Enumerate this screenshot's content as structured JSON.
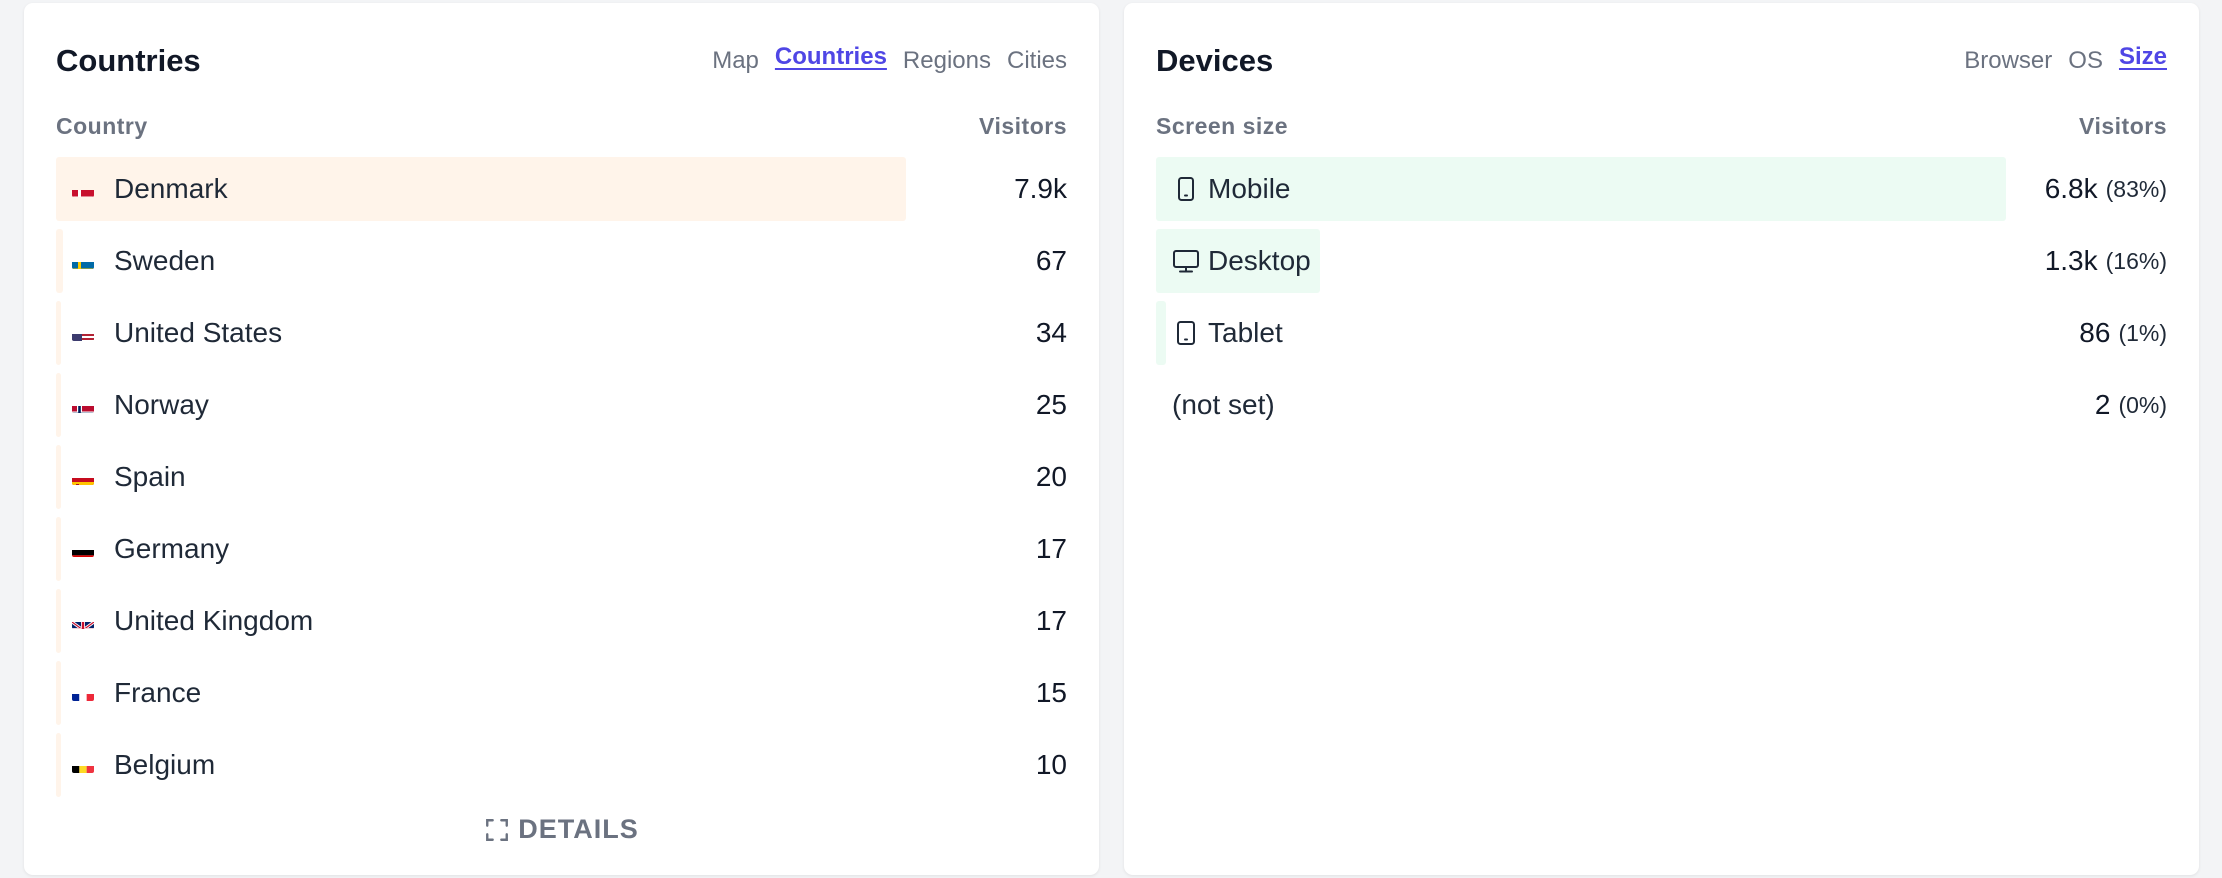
{
  "countries_card": {
    "title": "Countries",
    "tabs": [
      {
        "label": "Map",
        "active": false
      },
      {
        "label": "Countries",
        "active": true
      },
      {
        "label": "Regions",
        "active": false
      },
      {
        "label": "Cities",
        "active": false
      }
    ],
    "col_left": "Country",
    "col_right": "Visitors",
    "rows": [
      {
        "name": "Denmark",
        "value": "7.9k",
        "flag": "denmark-flag-icon",
        "share": 1.0
      },
      {
        "name": "Sweden",
        "value": "67",
        "flag": "sweden-flag-icon",
        "share": 0.0085
      },
      {
        "name": "United States",
        "value": "34",
        "flag": "united-states-flag-icon",
        "share": 0.0043
      },
      {
        "name": "Norway",
        "value": "25",
        "flag": "norway-flag-icon",
        "share": 0.0032
      },
      {
        "name": "Spain",
        "value": "20",
        "flag": "spain-flag-icon",
        "share": 0.0025
      },
      {
        "name": "Germany",
        "value": "17",
        "flag": "germany-flag-icon",
        "share": 0.0022
      },
      {
        "name": "United Kingdom",
        "value": "17",
        "flag": "united-kingdom-flag-icon",
        "share": 0.0022
      },
      {
        "name": "France",
        "value": "15",
        "flag": "france-flag-icon",
        "share": 0.0019
      },
      {
        "name": "Belgium",
        "value": "10",
        "flag": "belgium-flag-icon",
        "share": 0.0013
      }
    ],
    "details_label": "DETAILS"
  },
  "devices_card": {
    "title": "Devices",
    "tabs": [
      {
        "label": "Browser",
        "active": false
      },
      {
        "label": "OS",
        "active": false
      },
      {
        "label": "Size",
        "active": true
      }
    ],
    "col_left": "Screen size",
    "col_right": "Visitors",
    "rows": [
      {
        "name": "Mobile",
        "value": "6.8k",
        "pct": "(83%)",
        "icon": "mobile-icon",
        "share": 0.83
      },
      {
        "name": "Desktop",
        "value": "1.3k",
        "pct": "(16%)",
        "icon": "desktop-icon",
        "share": 0.16
      },
      {
        "name": "Tablet",
        "value": "86",
        "pct": "(1%)",
        "icon": "tablet-icon",
        "share": 0.01
      },
      {
        "name": "(not set)",
        "value": "2",
        "pct": "(0%)",
        "icon": "",
        "share": 0.0
      }
    ]
  },
  "colors": {
    "accent": "#4f46e5",
    "country_bar": "#fff4ea",
    "device_bar": "#ecfbf3",
    "muted": "#6b7280"
  }
}
